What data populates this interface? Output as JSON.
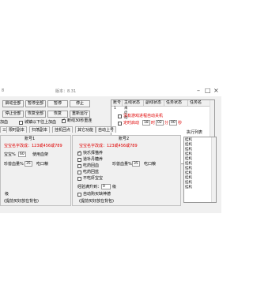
{
  "window": {
    "title_left": "8",
    "version": "版本：8.31",
    "min": "–",
    "max": "□",
    "close": "×"
  },
  "toolbar": {
    "start_all": "启动全部",
    "pause_all": "暂停全部",
    "pause": "暂停",
    "stop": "停止",
    "stop_all": "停止全部",
    "resume_all": "恢复全部",
    "resume": "恢复",
    "restart": "重新运行"
  },
  "grid": {
    "headers": [
      "账号",
      "主线状态",
      "副线状态",
      "任务状态",
      "任务名"
    ],
    "rows": [
      {
        "no": "1",
        "status": "未启动"
      }
    ]
  },
  "left_frag": {
    "add": "加血",
    "checkbox_label": "城镇以下往上加血"
  },
  "tabs": [
    "三",
    "限时副本",
    "扫荡副本",
    "挂机回点",
    "其它功能",
    "自动上号"
  ],
  "options": {
    "disconnect_reconnect": "断线30秒重连",
    "no_game_close": "没有游戏进程自动关机",
    "timed_start": "定时启动",
    "hour": "18",
    "hour_unit": "时",
    "minute": "02",
    "minute_unit": "分",
    "second": "00",
    "second_unit": "秒"
  },
  "exec_list": {
    "title": "执行列表",
    "items": [
      "挂机",
      "挂机",
      "挂机",
      "挂机",
      "挂机",
      "挂机",
      "挂机",
      "挂机",
      "挂机",
      "挂机",
      "挂机"
    ]
  },
  "account1": {
    "title": "账号1",
    "hint": "宝宝名字改成：123或456或789",
    "baby_hp_label": "宝宝%",
    "baby_hp_value": "60",
    "use_blood": "使用血架",
    "pearl_label": "珍兽血量%",
    "pearl_value": "35",
    "eat_label": "吃口粮",
    "level_label": "级",
    "backpack": "(提前买好放在背包)"
  },
  "account2": {
    "title": "账号2",
    "hint": "宝宝名字改成：123或456或789",
    "pet_label": "快乐择猫养",
    "hatch_label": "道补丹糖养",
    "eat_back": "吃药回血",
    "eat_blue": "吃药回蓝",
    "baby_label": "不吃虾宝宝",
    "pet_hp_label": "珍兽血量%",
    "pet_hp_value": "35",
    "eat_food": "吃口粮",
    "level_label": "经验满升到：",
    "level_value": "0",
    "level_unit": "级",
    "auto_buy": "自动购买缺神德",
    "backpack": "(提前买好放在背包)"
  }
}
